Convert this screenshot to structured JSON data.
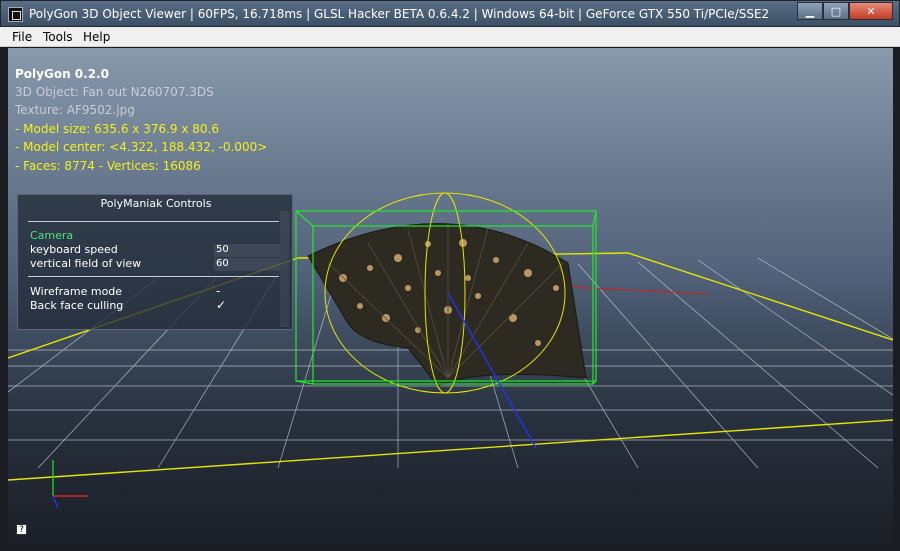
{
  "window": {
    "title": "PolyGon 3D Object Viewer | 60FPS, 16.718ms | GLSL Hacker BETA 0.6.4.2 | Windows 64-bit | GeForce GTX 550 Ti/PCIe/SSE2",
    "minimize": "▁",
    "maximize": "□",
    "close": "✕"
  },
  "menu": {
    "file": "File",
    "tools": "Tools",
    "help": "Help"
  },
  "info": {
    "app_name": "PolyGon 0.2.0",
    "object": "3D Object: Fan out N260707.3DS",
    "texture": "Texture: AF9502.jpg",
    "model_size": "- Model size:  635.6 x 376.9 x 80.6",
    "model_center": "- Model center:  <4.322, 188.432, -0.000>",
    "faces": "- Faces: 8774 - Vertices: 16086"
  },
  "panel": {
    "title": "PolyManiak Controls",
    "section_camera": "Camera",
    "keyboard_speed_label": "keyboard speed",
    "keyboard_speed_value": "50",
    "fov_label": "vertical field of view",
    "fov_value": "60",
    "wireframe_label": "Wireframe mode",
    "wireframe_value": "-",
    "backface_label": "Back face culling",
    "backface_value": "✓"
  },
  "help_button": "?",
  "colors": {
    "info_yellow": "#f3f219",
    "camera_green": "#4fe07a",
    "bbox_green": "#22e82a",
    "grid_yellow": "#e6e600"
  }
}
